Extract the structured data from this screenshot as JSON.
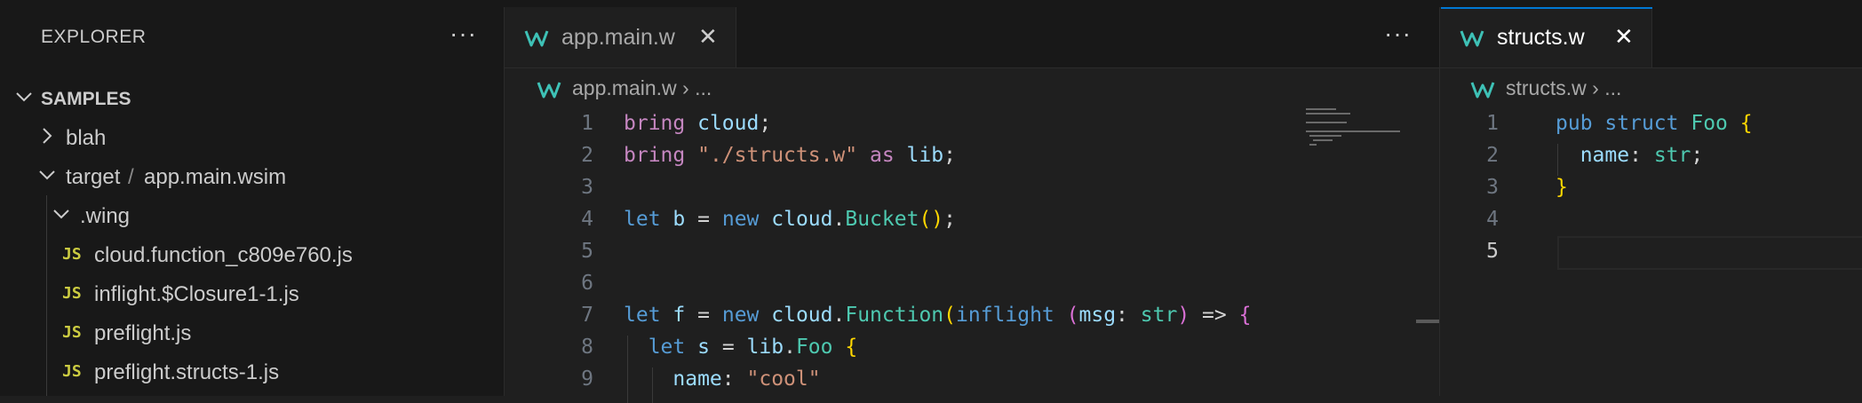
{
  "sidebar": {
    "title": "EXPLORER",
    "more": "···",
    "section": "SAMPLES",
    "items": [
      {
        "label": "blah",
        "icon": "chevron-right-icon"
      },
      {
        "label": "target",
        "sep": "/",
        "label2": "app.main.wsim",
        "icon": "chevron-down-icon"
      },
      {
        "label": ".wing",
        "icon": "chevron-down-icon"
      },
      {
        "label": "cloud.function_c809e760.js",
        "badge": "JS"
      },
      {
        "label": "inflight.$Closure1-1.js",
        "badge": "JS"
      },
      {
        "label": "preflight.js",
        "badge": "JS"
      },
      {
        "label": "preflight.structs-1.js",
        "badge": "JS"
      }
    ]
  },
  "editor_left": {
    "tab": {
      "name": "app.main.w",
      "close": "✕"
    },
    "more": "···",
    "breadcrumb": {
      "file": "app.main.w",
      "sep": " › ",
      "rest": "..."
    },
    "line_numbers": [
      "1",
      "2",
      "3",
      "4",
      "5",
      "6",
      "7",
      "8",
      "9"
    ]
  },
  "editor_right": {
    "tab": {
      "name": "structs.w",
      "close": "✕"
    },
    "breadcrumb": {
      "file": "structs.w",
      "sep": " › ",
      "rest": "..."
    },
    "line_numbers": [
      "1",
      "2",
      "3",
      "4",
      "5"
    ],
    "current_line": "5"
  },
  "colors": {
    "accent": "#0078d4",
    "wing_icon": "#3ec1b6",
    "js_badge": "#cbcb41"
  }
}
